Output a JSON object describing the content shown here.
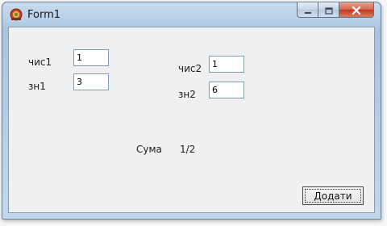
{
  "window": {
    "title": "Form1",
    "icon": "app-icon"
  },
  "caption_buttons": {
    "minimize": "minimize-icon",
    "maximize": "maximize-icon",
    "close": "close-icon"
  },
  "form": {
    "chys1_label": "чис1",
    "chys1_value": "1",
    "zn1_label": "зн1",
    "zn1_value": "3",
    "chys2_label": "чис2",
    "chys2_value": "1",
    "zn2_label": "зн2",
    "zn2_value": "6",
    "sum_label": "Сума",
    "sum_value": "1/2",
    "add_button_label": "Додати"
  },
  "colors": {
    "client_background": "#eef0f2",
    "close_button": "#c1391d",
    "input_border": "#7f9db9"
  }
}
